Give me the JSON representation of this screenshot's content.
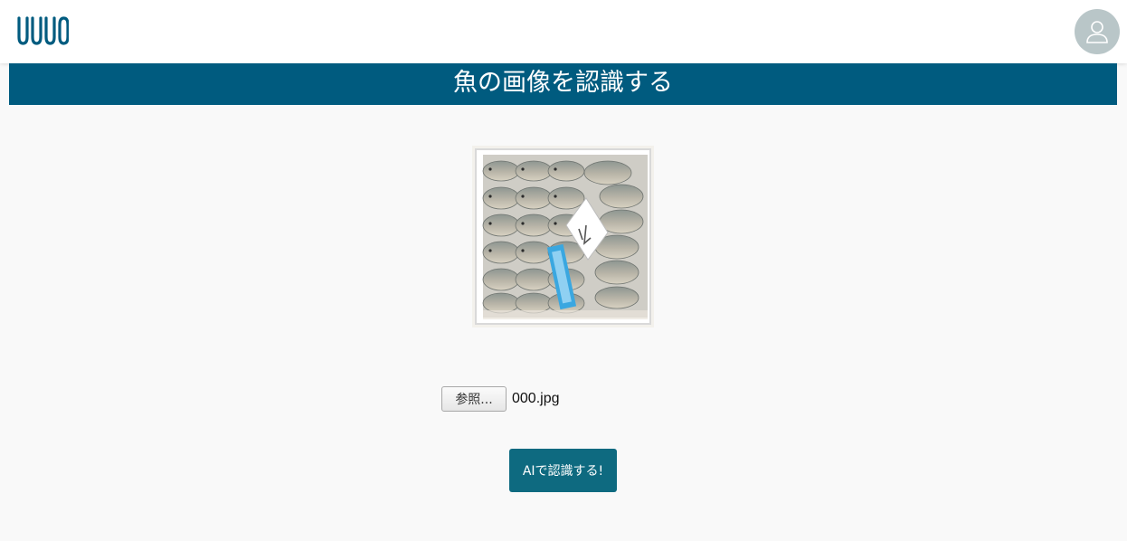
{
  "header": {
    "logo_icon": "uuuo-logo-icon",
    "avatar_icon": "user-icon"
  },
  "page": {
    "title": "魚の画像を認識する"
  },
  "preview": {
    "image_icon": "fish-box-photo"
  },
  "upload": {
    "browse_label": "参照...",
    "file_name": "000.jpg"
  },
  "actions": {
    "submit_label": "AIで認識する!"
  },
  "colors": {
    "brand": "#005b7f",
    "button": "#0e6a80",
    "avatar_bg": "#b9c6c8",
    "background": "#f9f9f9"
  }
}
